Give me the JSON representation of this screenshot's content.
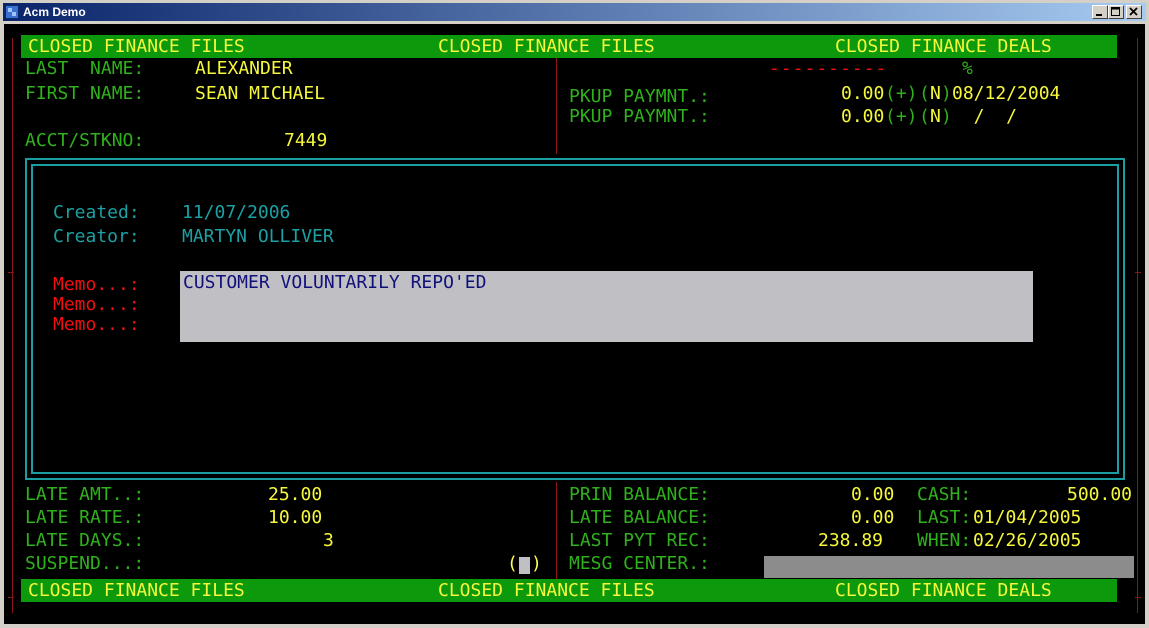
{
  "window": {
    "title": "Acm Demo"
  },
  "header_bar": {
    "left": "CLOSED FINANCE FILES",
    "center": "CLOSED FINANCE FILES",
    "right": "CLOSED FINANCE DEALS"
  },
  "footer_bar": {
    "left": "CLOSED FINANCE FILES",
    "center": "CLOSED FINANCE FILES",
    "right": "CLOSED FINANCE DEALS"
  },
  "top": {
    "last_name_label": "LAST  NAME:",
    "last_name_value": "ALEXANDER",
    "first_name_label": "FIRST NAME:",
    "first_name_value": "SEAN MICHAEL",
    "acct_label": "ACCT/STKNO:",
    "acct_value": "7449",
    "dashes": "----------",
    "percent": "%",
    "pkup1_label": "PKUP PAYMNT.:",
    "pkup1_amount": "0.00",
    "pkup1_plus": "(+)",
    "pkup1_paren_open": "(",
    "pkup1_flag": "N",
    "pkup1_paren_close": ")",
    "pkup1_date": "08/12/2004",
    "pkup2_label": "PKUP PAYMNT.:",
    "pkup2_amount": "0.00",
    "pkup2_plus": "(+)",
    "pkup2_paren_open": "(",
    "pkup2_flag": "N",
    "pkup2_paren_close": ")",
    "pkup2_date": "  /  /"
  },
  "memo_dialog": {
    "created_label": "Created:",
    "created_value": "11/07/2006",
    "creator_label": "Creator:",
    "creator_value": "MARTYN OLLIVER",
    "memo_label": "Memo...:",
    "memo_lines": [
      "CUSTOMER VOLUNTARILY REPO'ED",
      "",
      ""
    ]
  },
  "bottom": {
    "late_amt_label": "LATE AMT..:",
    "late_amt_value": "25.00",
    "late_rate_label": "LATE RATE.:",
    "late_rate_value": "10.00",
    "late_days_label": "LATE DAYS.:",
    "late_days_value": "3",
    "suspend_label": "SUSPEND...:",
    "suspend_paren_open": "(",
    "suspend_paren_close": ")",
    "prin_balance_label": "PRIN BALANCE:",
    "prin_balance_value": "0.00",
    "late_balance_label": "LATE BALANCE:",
    "late_balance_value": "0.00",
    "last_pyt_label": "LAST PYT REC:",
    "last_pyt_value": "238.89",
    "mesg_center_label": "MESG CENTER.:",
    "cash_label": "CASH:",
    "cash_value": "500.00",
    "last_label": "LAST:",
    "last_value": "01/04/2005",
    "when_label": "WHEN:",
    "when_value": "02/26/2005"
  },
  "colors": {
    "green": "#2fb11b",
    "yellow": "#f5f73c",
    "cyan": "#1ca0a3",
    "red": "#f01010",
    "bar": "#0c9a0c",
    "memo_bg": "#c0c0c4"
  }
}
